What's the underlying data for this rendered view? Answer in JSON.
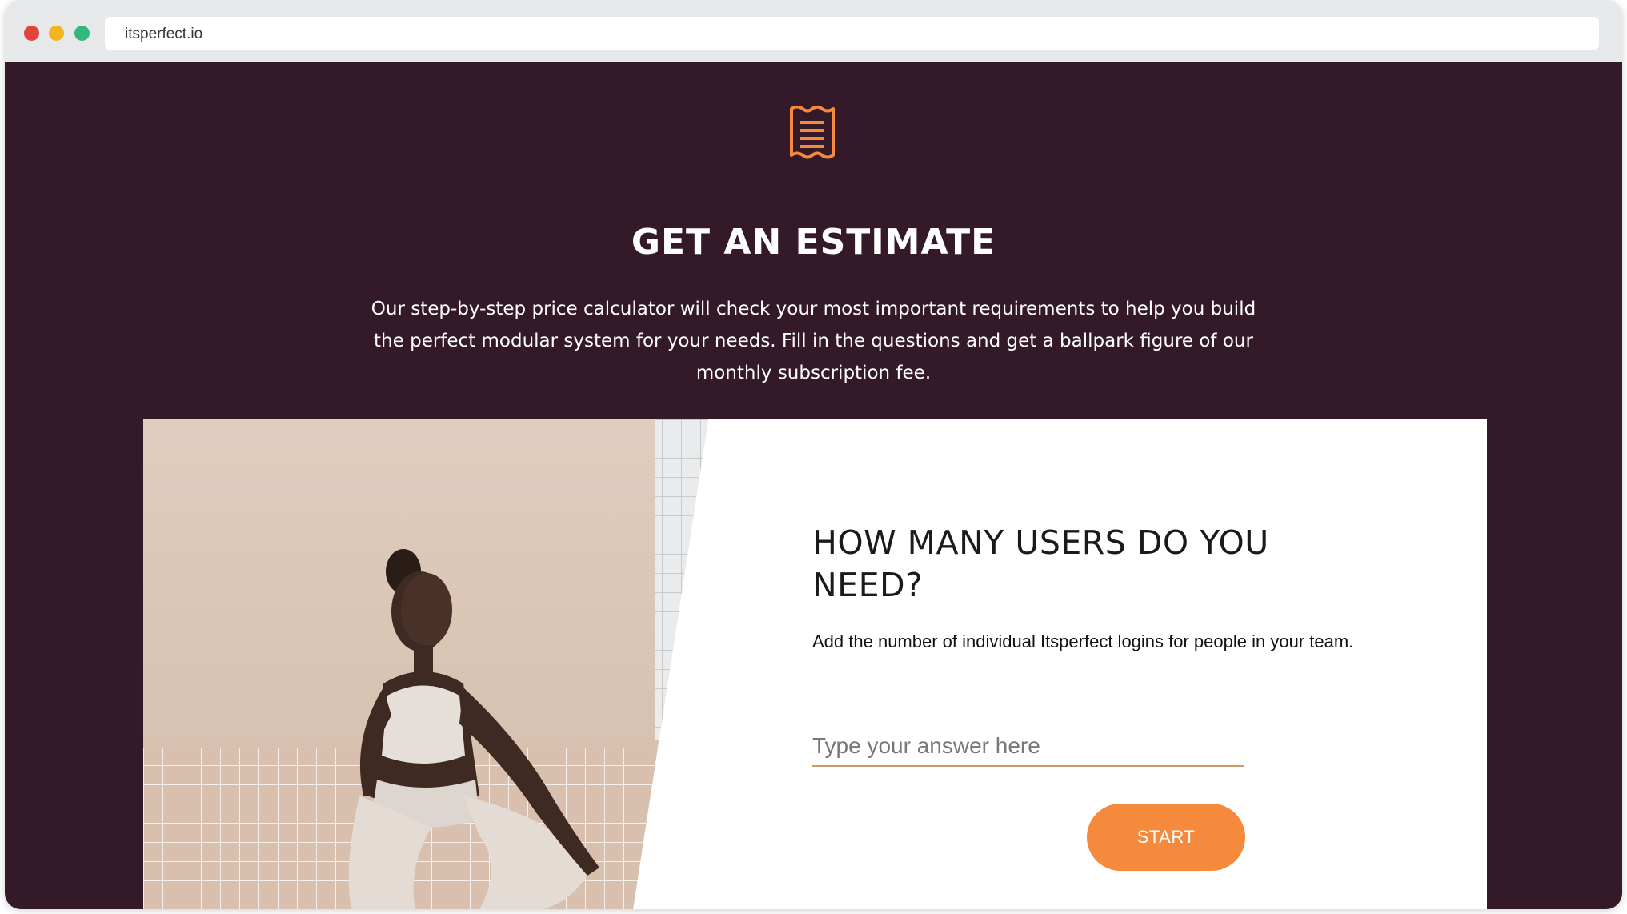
{
  "browser": {
    "url": "itsperfect.io"
  },
  "colors": {
    "page_background": "#341a29",
    "accent": "#f58a3d",
    "traffic_red": "#e0443a",
    "traffic_yellow": "#f0b51f",
    "traffic_green": "#34b77c",
    "heading_text": "#ffffff"
  },
  "icons": {
    "header_icon": "receipt-icon"
  },
  "header": {
    "title": "GET AN ESTIMATE",
    "description": "Our step-by-step price calculator will check your most important requirements to help you build the perfect modular system for your needs. Fill in the questions and get a ballpark figure of our monthly subscription fee."
  },
  "calculator": {
    "question": "HOW MANY USERS DO YOU NEED?",
    "helper_text": "Add the number of individual Itsperfect logins for people in your team.",
    "answer_placeholder": "Type your answer here",
    "start_label": "START"
  }
}
